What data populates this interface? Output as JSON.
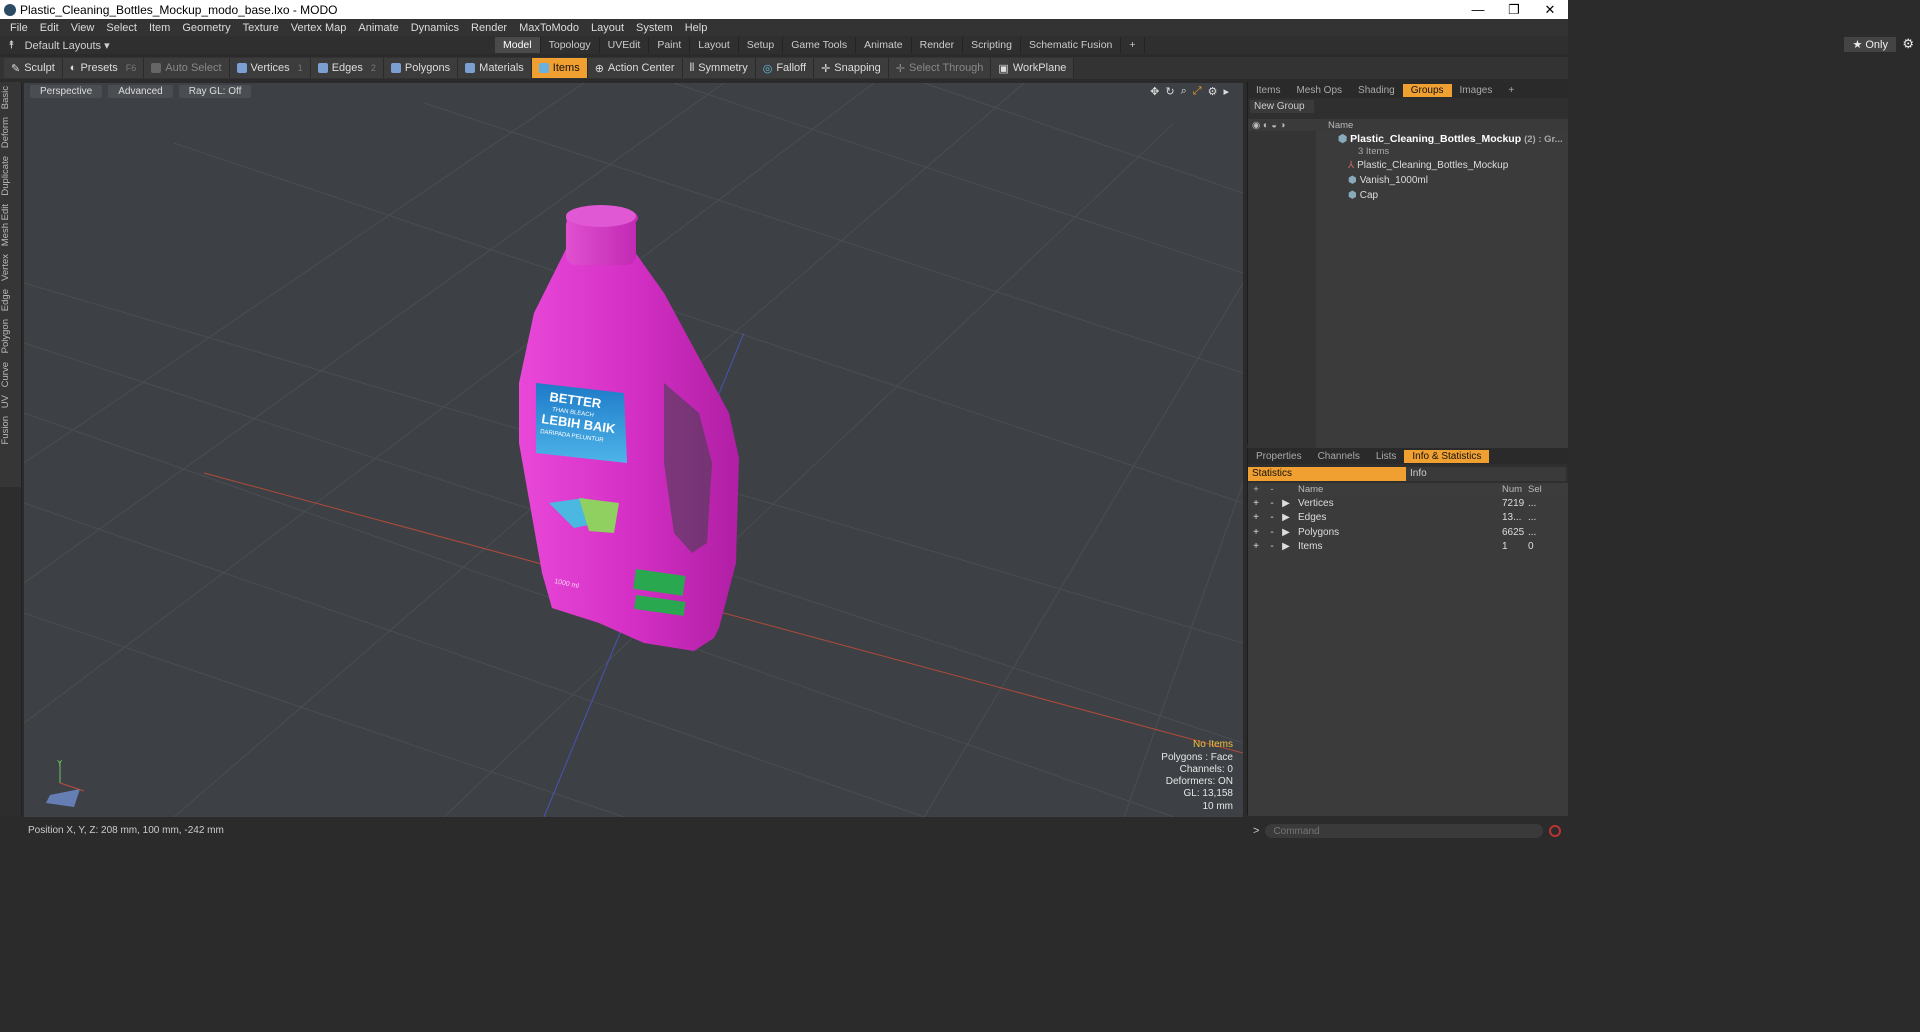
{
  "window": {
    "title": "Plastic_Cleaning_Bottles_Mockup_modo_base.lxo - MODO",
    "controls": [
      "—",
      "❐",
      "✕"
    ]
  },
  "menu": [
    "File",
    "Edit",
    "View",
    "Select",
    "Item",
    "Geometry",
    "Texture",
    "Vertex Map",
    "Animate",
    "Dynamics",
    "Render",
    "MaxToModo",
    "Layout",
    "System",
    "Help"
  ],
  "layout": {
    "selector": "Default Layouts ▾",
    "tabs": [
      "Model",
      "Topology",
      "UVEdit",
      "Paint",
      "Layout",
      "Setup",
      "Game Tools",
      "Animate",
      "Render",
      "Scripting",
      "Schematic Fusion"
    ],
    "add": "+",
    "only": "★ Only"
  },
  "toolbar": {
    "sculpt": "Sculpt",
    "presets": "Presets",
    "presets_key": "F6",
    "auto_select": "Auto Select",
    "vertices": "Vertices",
    "vertices_num": "1",
    "edges": "Edges",
    "edges_num": "2",
    "polygons": "Polygons",
    "materials": "Materials",
    "items": "Items",
    "action_center": "Action Center",
    "symmetry": "Symmetry",
    "falloff": "Falloff",
    "snapping": "Snapping",
    "select_through": "Select Through",
    "workplane": "WorkPlane"
  },
  "left_tabs": [
    "Basic",
    "Deform",
    "Duplicate",
    "Mesh Edit",
    "Vertex",
    "Edge",
    "Polygon",
    "Curve",
    "UV",
    "Fusion"
  ],
  "viewport": {
    "view": "Perspective",
    "shading": "Advanced",
    "raygl": "Ray GL: Off",
    "info": {
      "no_items": "No Items",
      "polygons": "Polygons : Face",
      "channels": "Channels: 0",
      "deformers": "Deformers: ON",
      "gl": "GL: 13,158",
      "scale": "10 mm"
    },
    "label_text": {
      "l1": "BETTER",
      "l2": "THAN BLEACH",
      "l3": "LEBIH BAIK",
      "l4": "DARIPADA PELUNTUR",
      "vol": "1000 ml"
    },
    "axis_y": "Y"
  },
  "status": {
    "position": "Position X, Y, Z:  208 mm, 100 mm, -242 mm"
  },
  "groups_panel": {
    "tabs": [
      "Items",
      "Mesh Ops",
      "Shading",
      "Groups",
      "Images"
    ],
    "new_group": "New Group",
    "column_name": "Name",
    "root": {
      "name": "Plastic_Cleaning_Bottles_Mockup",
      "suffix": "(2) : Gr...",
      "count": "3 Items"
    },
    "children": [
      "Plastic_Cleaning_Bottles_Mockup",
      "Vanish_1000ml",
      "Cap"
    ]
  },
  "stats_panel": {
    "tabs": [
      "Properties",
      "Channels",
      "Lists",
      "Info & Statistics"
    ],
    "subtabs": [
      "Statistics",
      "Info"
    ],
    "headers": {
      "name": "Name",
      "num": "Num",
      "sel": "Sel"
    },
    "rows": [
      {
        "name": "Vertices",
        "num": "7219",
        "sel": "..."
      },
      {
        "name": "Edges",
        "num": "13...",
        "sel": "..."
      },
      {
        "name": "Polygons",
        "num": "6625",
        "sel": "..."
      },
      {
        "name": "Items",
        "num": "1",
        "sel": "0"
      }
    ]
  },
  "command": {
    "prompt": ">",
    "placeholder": "Command"
  },
  "colors": {
    "accent": "#f0a030",
    "bottle": "#d02bc3",
    "viewport_bg": "#3d4145"
  }
}
